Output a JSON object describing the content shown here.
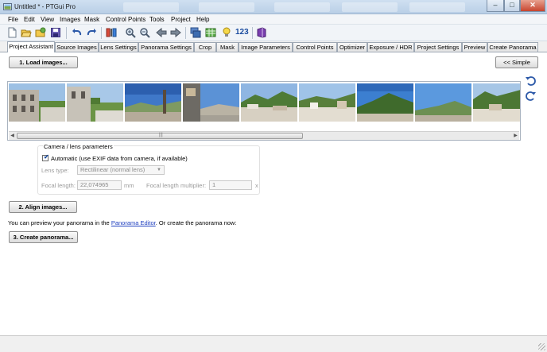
{
  "window": {
    "title": "Untitled * - PTGui Pro"
  },
  "menu": [
    "File",
    "Edit",
    "View",
    "Images",
    "Mask",
    "Control Points",
    "Tools",
    "Project",
    "Help"
  ],
  "toolbar": {
    "number_label": "123"
  },
  "tabs": [
    "Project Assistant",
    "Source Images",
    "Lens Settings",
    "Panorama Settings",
    "Crop",
    "Mask",
    "Image Parameters",
    "Control Points",
    "Optimizer",
    "Exposure / HDR",
    "Project Settings",
    "Preview",
    "Create Panorama"
  ],
  "assistant": {
    "load_button": "1. Load images...",
    "simple_button": "<< Simple",
    "camera": {
      "group_title": "Camera / lens parameters",
      "automatic_label": "Automatic (use EXIF data from camera, if available)",
      "lens_type_label": "Lens type:",
      "lens_type_value": "Rectilinear (normal lens)",
      "focal_length_label": "Focal length:",
      "focal_length_value": "22,074965",
      "focal_length_unit": "mm",
      "multiplier_label": "Focal length multiplier:",
      "multiplier_value": "1",
      "multiplier_unit": "x"
    },
    "align_button": "2. Align images...",
    "preview_text_before": "You can preview your panorama in the",
    "preview_link": "Panorama Editor",
    "preview_text_after": ". Or create the panorama now:",
    "create_button": "3. Create panorama..."
  }
}
